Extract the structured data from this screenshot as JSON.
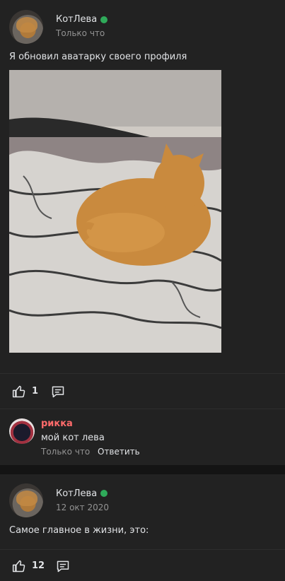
{
  "posts": [
    {
      "author": "КотЛева",
      "time": "Только что",
      "text": "Я обновил аватарку своего профиля",
      "likes": "1"
    },
    {
      "author": "КотЛева",
      "time": "12 окт 2020",
      "text": "Самое главное в жизни, это:",
      "likes": "12"
    }
  ],
  "comment": {
    "author": "рикка",
    "text": "мой кот лева",
    "time": "Только что",
    "reply_label": "Ответить"
  },
  "colors": {
    "page_bg": "#141414",
    "card_bg": "#222222",
    "online": "#2faa5a",
    "comment_author": "#ff6b6b"
  },
  "icons": [
    "like-icon",
    "comment-icon",
    "online-indicator"
  ]
}
